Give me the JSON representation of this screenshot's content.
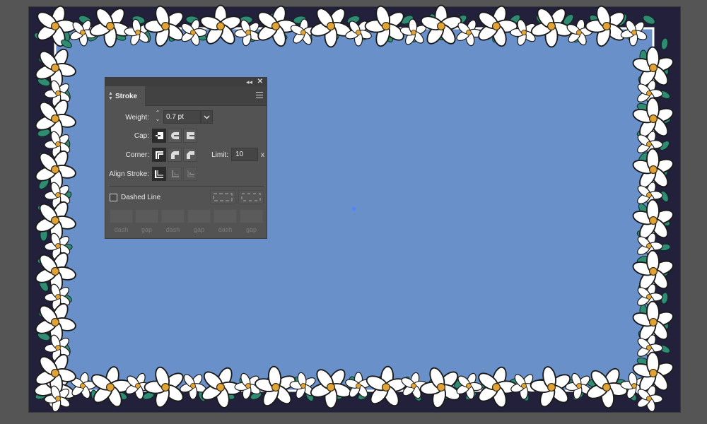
{
  "panel": {
    "title": "Stroke",
    "collapse_icon": "double-chevron-left-icon",
    "close_icon": "close-icon",
    "menu_icon": "hamburger-menu-icon"
  },
  "weight": {
    "label": "Weight:",
    "value": "0.7 pt"
  },
  "cap": {
    "label": "Cap:",
    "options": [
      "butt-cap",
      "round-cap",
      "projecting-cap"
    ],
    "selected": 0
  },
  "corner": {
    "label": "Corner:",
    "options": [
      "miter-join",
      "round-join",
      "bevel-join"
    ],
    "selected": 0
  },
  "limit": {
    "label": "Limit:",
    "value": "10",
    "suffix": "x"
  },
  "align_stroke": {
    "label": "Align Stroke:",
    "options": [
      "align-center",
      "align-inside",
      "align-outside"
    ],
    "selected": 0
  },
  "dashed_line": {
    "label": "Dashed Line",
    "checked": false
  },
  "dash_gap": {
    "labels": [
      "dash",
      "gap",
      "dash",
      "gap",
      "dash",
      "gap"
    ]
  },
  "colors": {
    "canvas_bg": "#555555",
    "artboard_bg": "#22203a",
    "fill_blue": "#6990c9",
    "panel_bg": "#535353",
    "anchor": "#4f86ff"
  }
}
